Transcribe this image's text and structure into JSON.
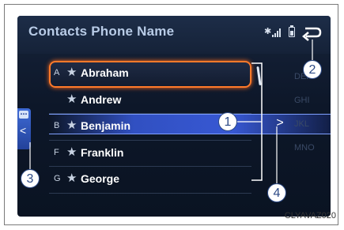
{
  "header": {
    "title": "Contacts Phone Name",
    "status_icons": [
      "bluetooth-icon",
      "signal-strength-icon",
      "battery-icon"
    ],
    "back_icon": "back-arrow-icon"
  },
  "contacts": [
    {
      "letter": "A",
      "star": "★",
      "name": "Abraham",
      "selected": true
    },
    {
      "letter": "",
      "star": "★",
      "name": "Andrew",
      "selected": false
    },
    {
      "letter": "B",
      "star": "★",
      "name": "Benjamin",
      "selected": false
    },
    {
      "letter": "F",
      "star": "★",
      "name": "Franklin",
      "selected": false
    },
    {
      "letter": "G",
      "star": "★",
      "name": "George",
      "selected": false
    }
  ],
  "alpha_index": [
    "DEF",
    "GHI",
    "JKL",
    "MNO"
  ],
  "side_tab": {
    "dots": "…",
    "arrow": "<"
  },
  "jump_arrow": ">",
  "callouts": [
    "1",
    "2",
    "3",
    "4"
  ],
  "caption": "CLYAVAZ020",
  "colors": {
    "selected_border": "#ff7a2a",
    "highlight_band": "#3a5fe0",
    "title_text": "#b8cbe6",
    "callout": "#2d4a86"
  }
}
